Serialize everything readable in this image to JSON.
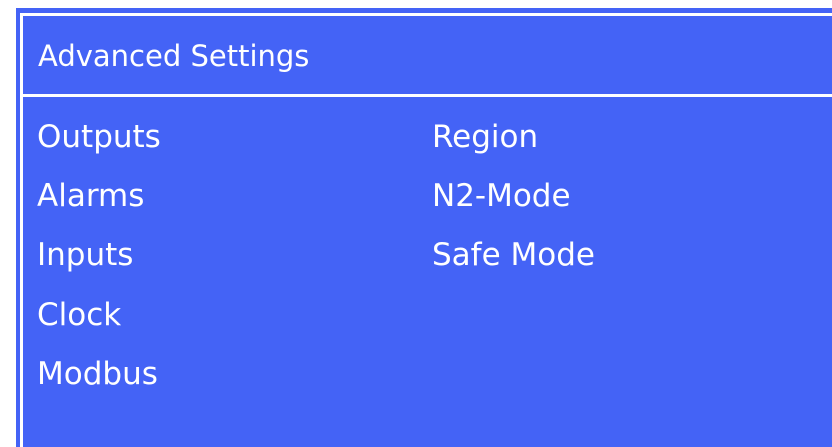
{
  "window": {
    "title": "Advanced Settings"
  },
  "menu": {
    "left": [
      "Outputs",
      "Alarms",
      "Inputs",
      "Clock",
      "Modbus"
    ],
    "right": [
      "Region",
      "N2-Mode",
      "Safe Mode"
    ]
  },
  "colors": {
    "background": "#4463f6",
    "text": "#ffffff",
    "border": "#ffffff"
  }
}
